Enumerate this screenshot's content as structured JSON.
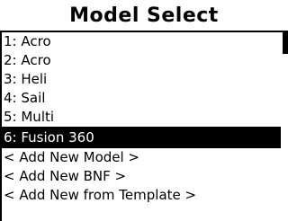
{
  "title": "Model Select",
  "models": [
    {
      "label": "1: Acro"
    },
    {
      "label": "2: Acro"
    },
    {
      "label": "3: Heli"
    },
    {
      "label": "4: Sail"
    },
    {
      "label": "5: Multi"
    },
    {
      "label": "6: Fusion 360",
      "selected": true
    }
  ],
  "actions": [
    {
      "label": "< Add New Model >"
    },
    {
      "label": "< Add New BNF >"
    },
    {
      "label": "< Add New from Template >"
    }
  ],
  "colors": {
    "background": "#ffffff",
    "foreground": "#000000",
    "highlight": "#000000"
  }
}
